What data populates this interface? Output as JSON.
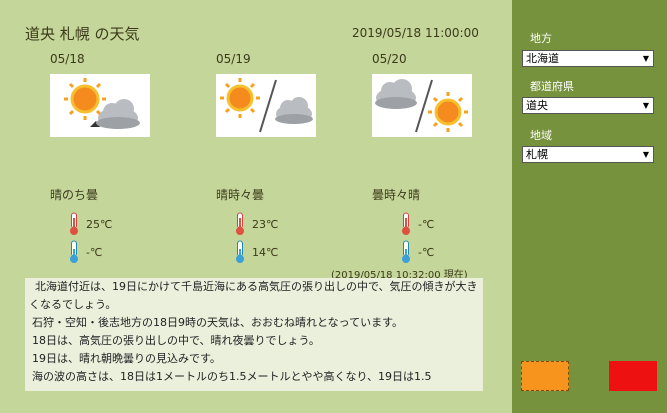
{
  "header": {
    "title": "道央 札幌 の天気",
    "datetime": "2019/05/18 11:00:00"
  },
  "forecast": [
    {
      "date": "05/18",
      "condition": "晴のち曇",
      "icon": "sun-then-cloud-icon",
      "high": "25℃",
      "low": "-℃"
    },
    {
      "date": "05/19",
      "condition": "晴時々曇",
      "icon": "sun-sometimes-cloud-icon",
      "high": "23℃",
      "low": "14℃"
    },
    {
      "date": "05/20",
      "condition": "曇時々晴",
      "icon": "cloud-sometimes-sun-icon",
      "high": "-℃",
      "low": "-℃"
    }
  ],
  "observed": "(2019/05/18 10:32:00 現在)",
  "news": {
    "lines": [
      "北海道付近は、19日にかけて千島近海にある高気圧の張り出しの中で、気圧の傾きが大きくなるでしょう。",
      "石狩・空知・後志地方の18日9時の天気は、おおむね晴れとなっています。",
      "18日は、高気圧の張り出しの中で、晴れ夜曇りでしょう。",
      "19日は、晴れ朝晩曇りの見込みです。",
      "海の波の高さは、18日は1メートルのち1.5メートルとやや高くなり、19日は1.5"
    ]
  },
  "sidebar": {
    "region_label": "地方",
    "region_value": "北海道",
    "prefecture_label": "都道府県",
    "prefecture_value": "道央",
    "area_label": "地域",
    "area_value": "札幌"
  },
  "colors": {
    "main_bg": "#c5d69a",
    "sidebar_bg": "#76923c",
    "orange_button": "#f7941d",
    "red_button": "#ee1111",
    "thermo_high": "#e05040",
    "thermo_low": "#3aa0d8"
  }
}
